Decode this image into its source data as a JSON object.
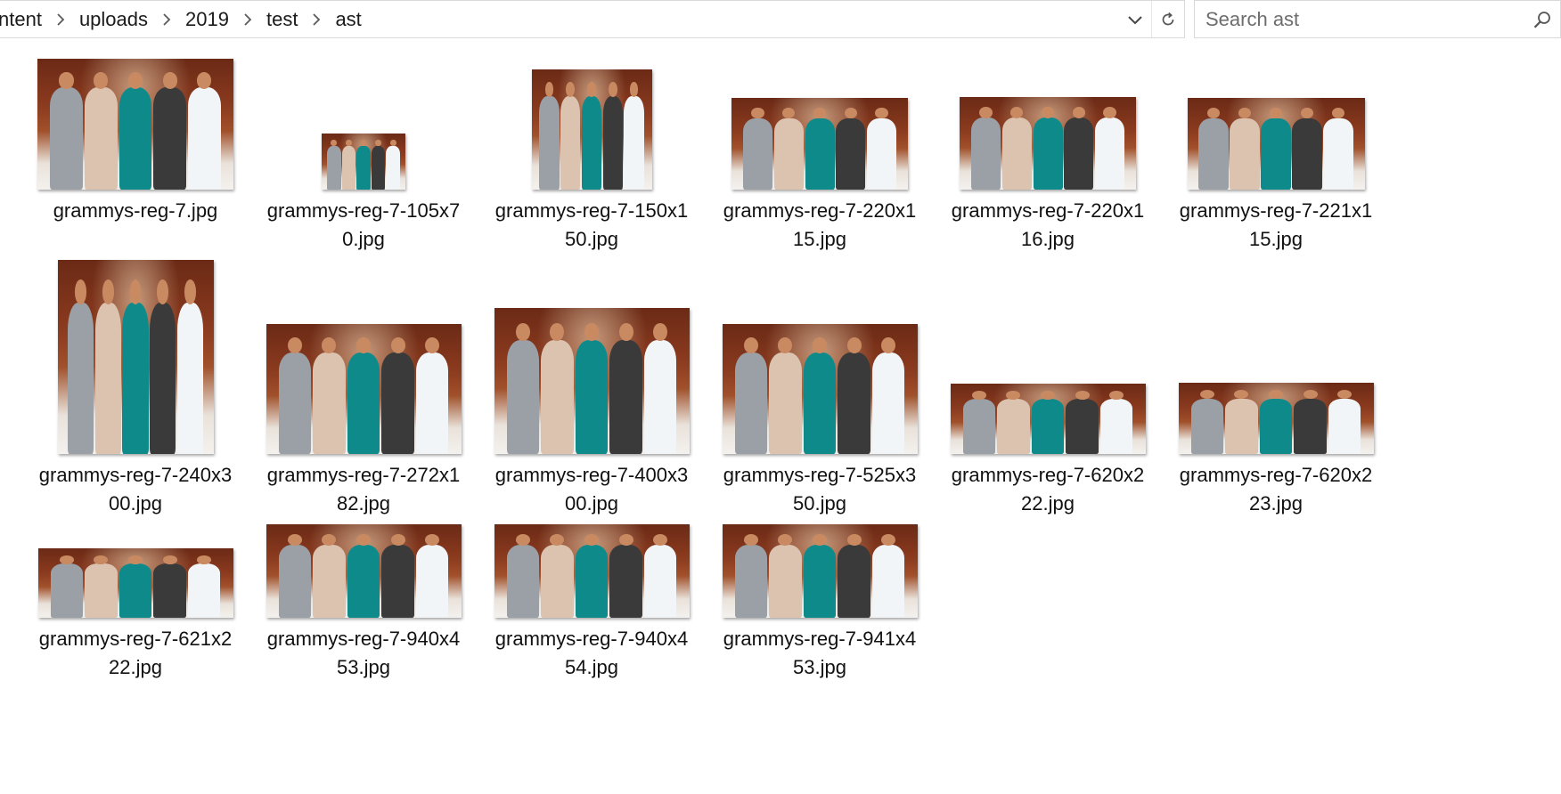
{
  "address_bar": {
    "breadcrumbs": [
      "ntent",
      "uploads",
      "2019",
      "test",
      "ast"
    ]
  },
  "search": {
    "placeholder": "Search ast",
    "value": ""
  },
  "icons": {
    "breadcrumb_separator": "chevron-right-icon",
    "dropdown": "chevron-down-icon",
    "refresh": "refresh-icon",
    "search": "search-icon",
    "thumbnail": "image-thumbnail"
  },
  "colors": {
    "text": "#1b1b1b",
    "border": "#d9d9d9",
    "placeholder": "#6d6d6d"
  },
  "files": [
    {
      "name": "grammys-reg-7.jpg",
      "label_lines": [
        "grammys-reg-7.jpg"
      ]
    },
    {
      "name": "grammys-reg-7-105x70.jpg",
      "label_lines": [
        "grammys-reg-7-105x7",
        "0.jpg"
      ]
    },
    {
      "name": "grammys-reg-7-150x150.jpg",
      "label_lines": [
        "grammys-reg-7-150x1",
        "50.jpg"
      ]
    },
    {
      "name": "grammys-reg-7-220x115.jpg",
      "label_lines": [
        "grammys-reg-7-220x1",
        "15.jpg"
      ]
    },
    {
      "name": "grammys-reg-7-220x116.jpg",
      "label_lines": [
        "grammys-reg-7-220x1",
        "16.jpg"
      ]
    },
    {
      "name": "grammys-reg-7-221x115.jpg",
      "label_lines": [
        "grammys-reg-7-221x1",
        "15.jpg"
      ]
    },
    {
      "name": "grammys-reg-7-240x300.jpg",
      "label_lines": [
        "grammys-reg-7-240x3",
        "00.jpg"
      ]
    },
    {
      "name": "grammys-reg-7-272x182.jpg",
      "label_lines": [
        "grammys-reg-7-272x1",
        "82.jpg"
      ]
    },
    {
      "name": "grammys-reg-7-400x300.jpg",
      "label_lines": [
        "grammys-reg-7-400x3",
        "00.jpg"
      ]
    },
    {
      "name": "grammys-reg-7-525x350.jpg",
      "label_lines": [
        "grammys-reg-7-525x3",
        "50.jpg"
      ]
    },
    {
      "name": "grammys-reg-7-620x222.jpg",
      "label_lines": [
        "grammys-reg-7-620x2",
        "22.jpg"
      ]
    },
    {
      "name": "grammys-reg-7-620x223.jpg",
      "label_lines": [
        "grammys-reg-7-620x2",
        "23.jpg"
      ]
    },
    {
      "name": "grammys-reg-7-621x222.jpg",
      "label_lines": [
        "grammys-reg-7-621x2",
        "22.jpg"
      ]
    },
    {
      "name": "grammys-reg-7-940x453.jpg",
      "label_lines": [
        "grammys-reg-7-940x4",
        "53.jpg"
      ]
    },
    {
      "name": "grammys-reg-7-940x454.jpg",
      "label_lines": [
        "grammys-reg-7-940x4",
        "54.jpg"
      ]
    },
    {
      "name": "grammys-reg-7-941x453.jpg",
      "label_lines": [
        "grammys-reg-7-941x4",
        "53.jpg"
      ]
    }
  ]
}
